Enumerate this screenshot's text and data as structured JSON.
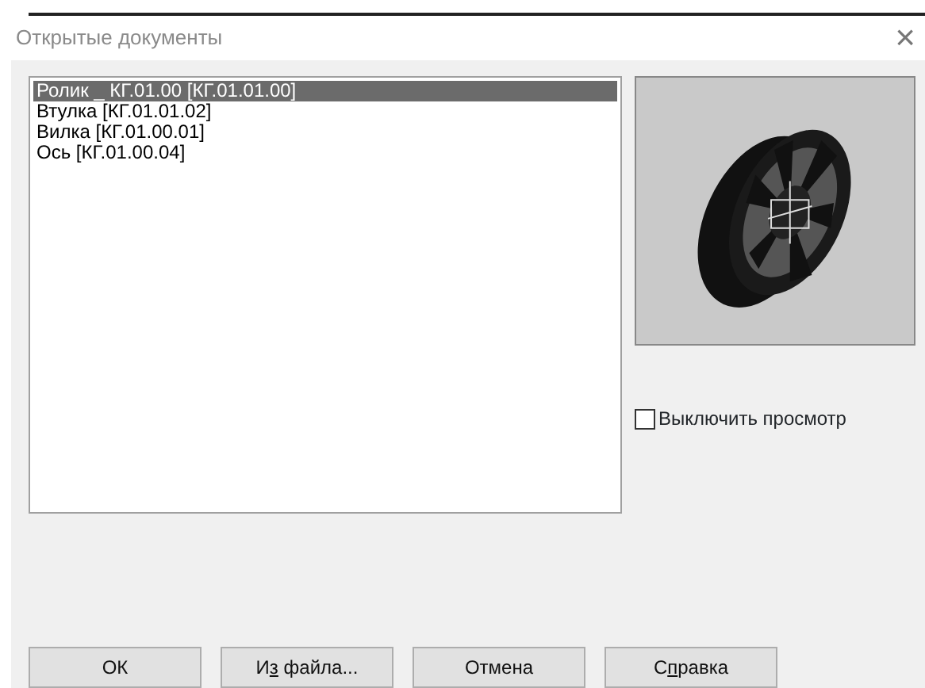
{
  "window": {
    "title": "Открытые документы",
    "close": "×"
  },
  "documents": [
    {
      "label": "Ролик _ КГ.01.00 [КГ.01.01.00]",
      "selected": true
    },
    {
      "label": "Втулка [КГ.01.01.02]",
      "selected": false
    },
    {
      "label": "Вилка [КГ.01.00.01]",
      "selected": false
    },
    {
      "label": "Ось [КГ.01.00.04]",
      "selected": false
    }
  ],
  "disable_preview": {
    "label": "Выключить просмотр",
    "checked": false
  },
  "buttons": [
    {
      "parts": [
        {
          "text": "ОК",
          "underlined": false
        }
      ]
    },
    {
      "parts": [
        {
          "text": "И",
          "underlined": false
        },
        {
          "text": "з",
          "underlined": true
        },
        {
          "text": " файла...",
          "underlined": false
        }
      ]
    },
    {
      "parts": [
        {
          "text": "Отмена",
          "underlined": false
        }
      ]
    },
    {
      "parts": [
        {
          "text": "С",
          "underlined": false
        },
        {
          "text": "п",
          "underlined": true
        },
        {
          "text": "равка",
          "underlined": false
        }
      ]
    }
  ]
}
